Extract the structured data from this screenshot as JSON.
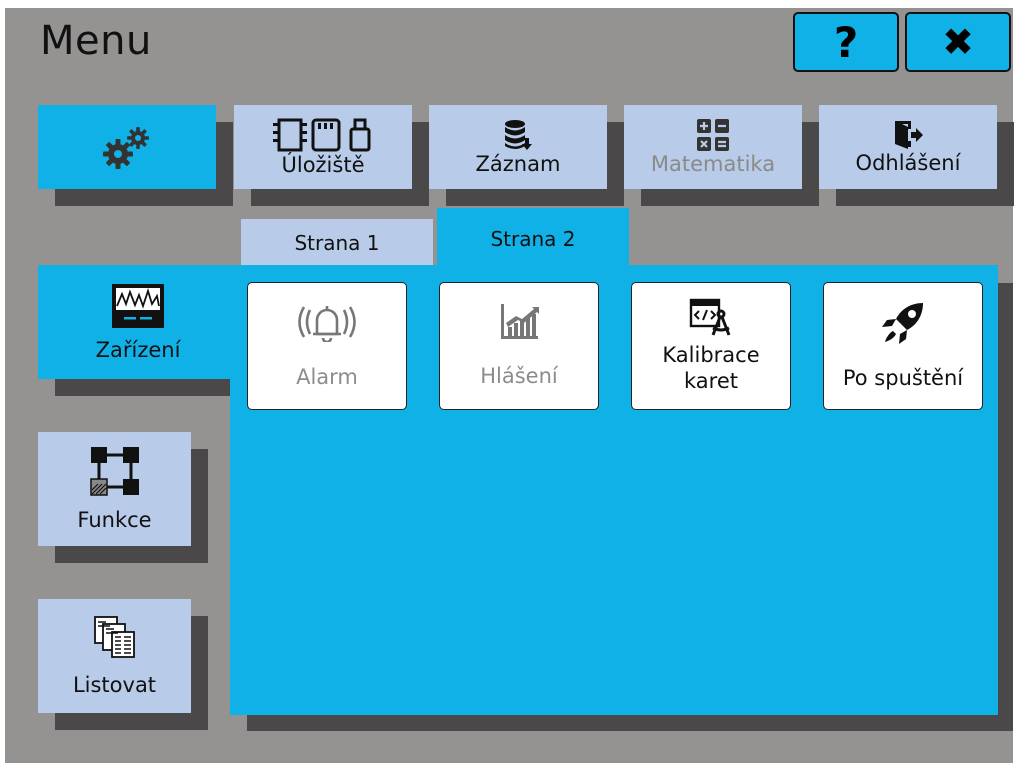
{
  "header": {
    "title": "Menu",
    "help_label": "?",
    "close_label": "✖"
  },
  "top_menu": {
    "settings": {
      "icon": "gears-icon"
    },
    "storage": {
      "label": "Úložiště",
      "icon": "storage-icon"
    },
    "record": {
      "label": "Záznam",
      "icon": "database-icon"
    },
    "math": {
      "label": "Matematika",
      "icon": "calculator-icon",
      "disabled": true
    },
    "logout": {
      "label": "Odhlášení",
      "icon": "exit-icon"
    }
  },
  "tabs": [
    {
      "label": "Strana 1",
      "active": false
    },
    {
      "label": "Strana 2",
      "active": true
    }
  ],
  "side_menu": {
    "device": {
      "label": "Zařízení",
      "icon": "monitor-icon"
    },
    "functions": {
      "label": "Funkce",
      "icon": "network-icon"
    },
    "browse": {
      "label": "Listovat",
      "icon": "documents-icon"
    }
  },
  "cards": [
    {
      "label": "Alarm",
      "icon": "bell-icon",
      "disabled": true
    },
    {
      "label": "Hlášení",
      "icon": "report-chart-icon",
      "disabled": true
    },
    {
      "label": "Kalibrace\nkaret",
      "icon": "calibration-icon",
      "disabled": false
    },
    {
      "label": "Po spuštění",
      "icon": "rocket-icon",
      "disabled": false
    }
  ],
  "colors": {
    "accent": "#10b1e6",
    "button": "#b8cbe8",
    "background": "#959292",
    "shadow": "#4a4848"
  }
}
